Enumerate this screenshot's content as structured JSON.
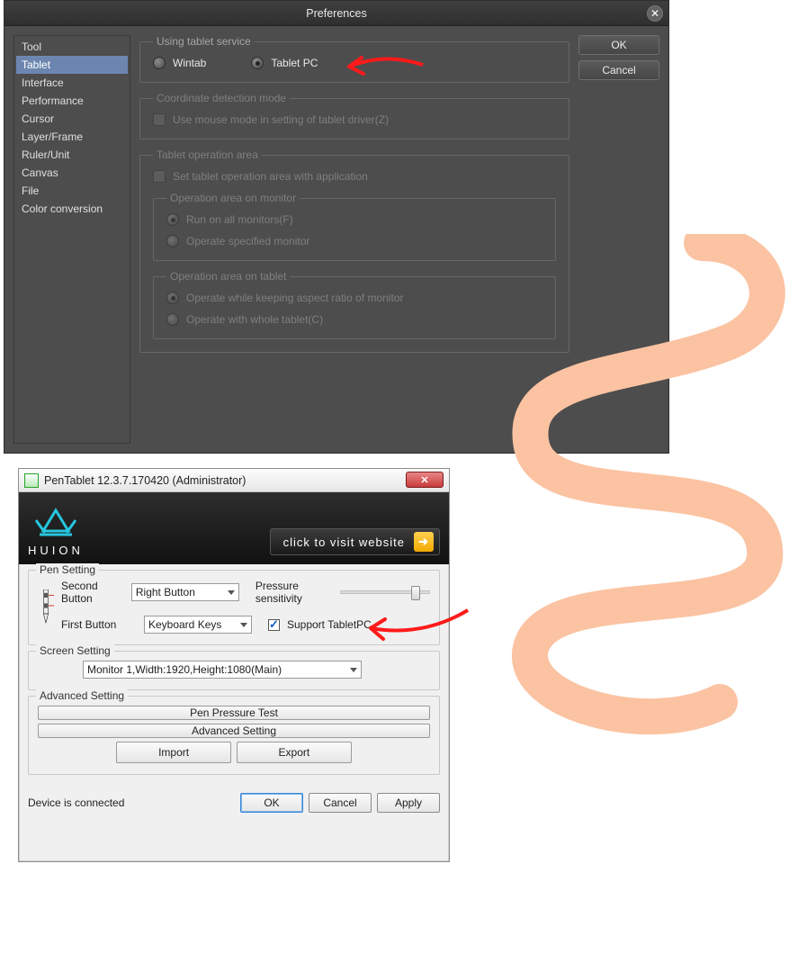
{
  "prefs": {
    "title": "Preferences",
    "sidebar": [
      {
        "label": "Tool"
      },
      {
        "label": "Tablet",
        "selected": true
      },
      {
        "label": "Interface"
      },
      {
        "label": "Performance"
      },
      {
        "label": "Cursor"
      },
      {
        "label": "Layer/Frame"
      },
      {
        "label": "Ruler/Unit"
      },
      {
        "label": "Canvas"
      },
      {
        "label": "File"
      },
      {
        "label": "Color conversion"
      }
    ],
    "buttons": {
      "ok": "OK",
      "cancel": "Cancel"
    },
    "tablet_service": {
      "legend": "Using tablet service",
      "wintab": "Wintab",
      "tabletpc": "Tablet PC",
      "selected": "tabletpc"
    },
    "coord_mode": {
      "legend": "Coordinate detection mode",
      "mouse_mode": "Use mouse mode in setting of tablet driver(Z)"
    },
    "op_area": {
      "legend": "Tablet operation area",
      "set_with_app": "Set tablet operation area with application",
      "monitor": {
        "legend": "Operation area on monitor",
        "run_all": "Run on all monitors(F)",
        "specified": "Operate specified monitor"
      },
      "tablet": {
        "legend": "Operation area on tablet",
        "keep_ratio": "Operate while keeping aspect ratio of monitor",
        "whole": "Operate with whole tablet(C)"
      }
    }
  },
  "huion": {
    "title": "PenTablet 12.3.7.170420 (Administrator)",
    "brand_text": "HUION",
    "visit": "click to visit website",
    "pen_setting": {
      "legend": "Pen Setting",
      "second_btn_label": "Second Button",
      "second_btn_value": "Right Button",
      "first_btn_label": "First Button",
      "first_btn_value": "Keyboard Keys",
      "pressure_label": "Pressure sensitivity",
      "support_tabletpc": "Support TabletPC"
    },
    "screen_setting": {
      "legend": "Screen Setting",
      "value": "Monitor 1,Width:1920,Height:1080(Main)"
    },
    "advanced": {
      "legend": "Advanced Setting",
      "pressure_test": "Pen Pressure Test",
      "advanced_btn": "Advanced Setting",
      "import": "Import",
      "export": "Export"
    },
    "status": "Device is connected",
    "ok": "OK",
    "cancel": "Cancel",
    "apply": "Apply"
  }
}
